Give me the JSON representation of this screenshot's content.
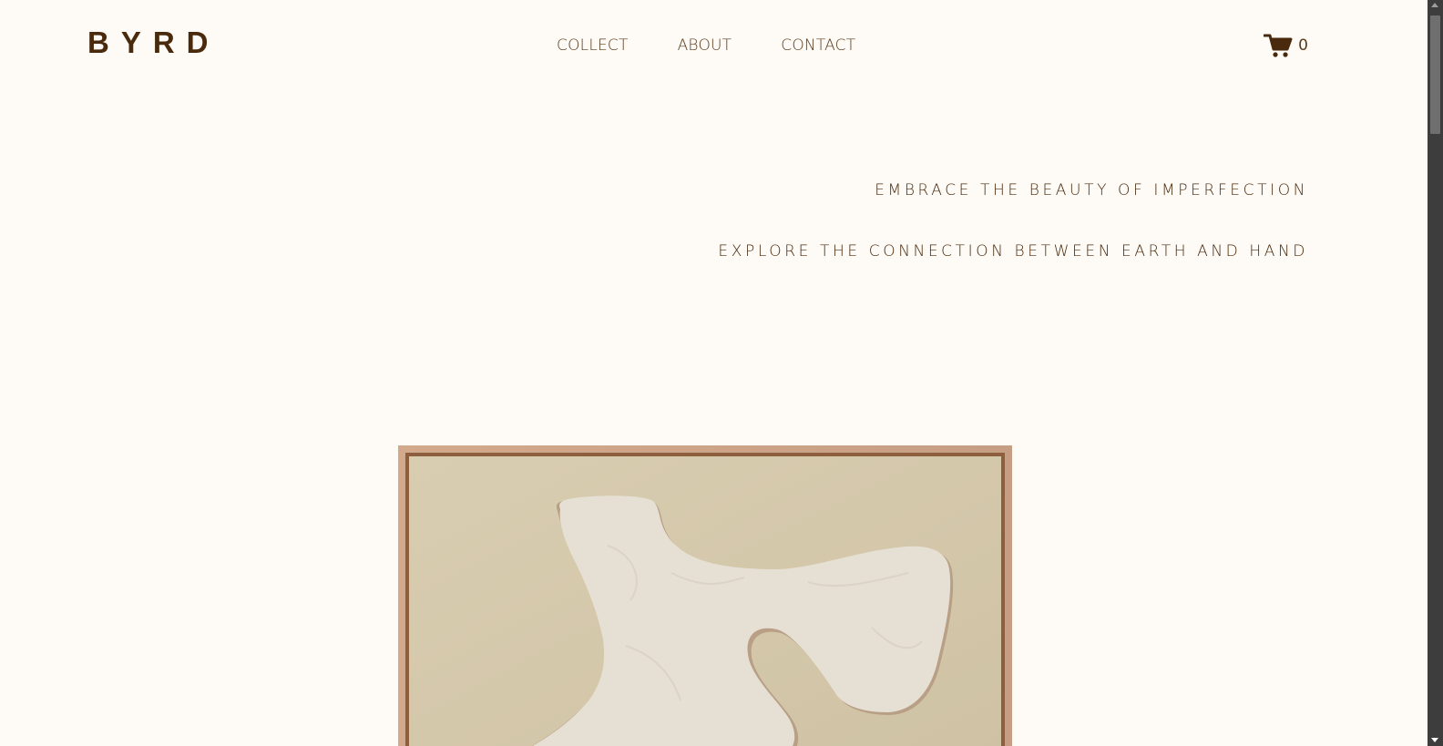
{
  "header": {
    "logo": "BYRD",
    "nav": [
      {
        "label": "COLLECT"
      },
      {
        "label": "ABOUT"
      },
      {
        "label": "CONTACT"
      }
    ],
    "cart": {
      "icon": "cart-icon",
      "count": "0"
    }
  },
  "hero": {
    "tagline_1": "EMBRACE THE BEAUTY OF IMPERFECTION",
    "tagline_2": "EXPLORE THE CONNECTION BETWEEN EARTH AND HAND"
  },
  "colors": {
    "background": "#fefbf6",
    "brand_text": "#4a2a0c",
    "frame_wood": "#c79a7a",
    "canvas": "#d8ccb0",
    "plaster": "#e4ddd0",
    "scrollbar": "#3d3d3d"
  }
}
